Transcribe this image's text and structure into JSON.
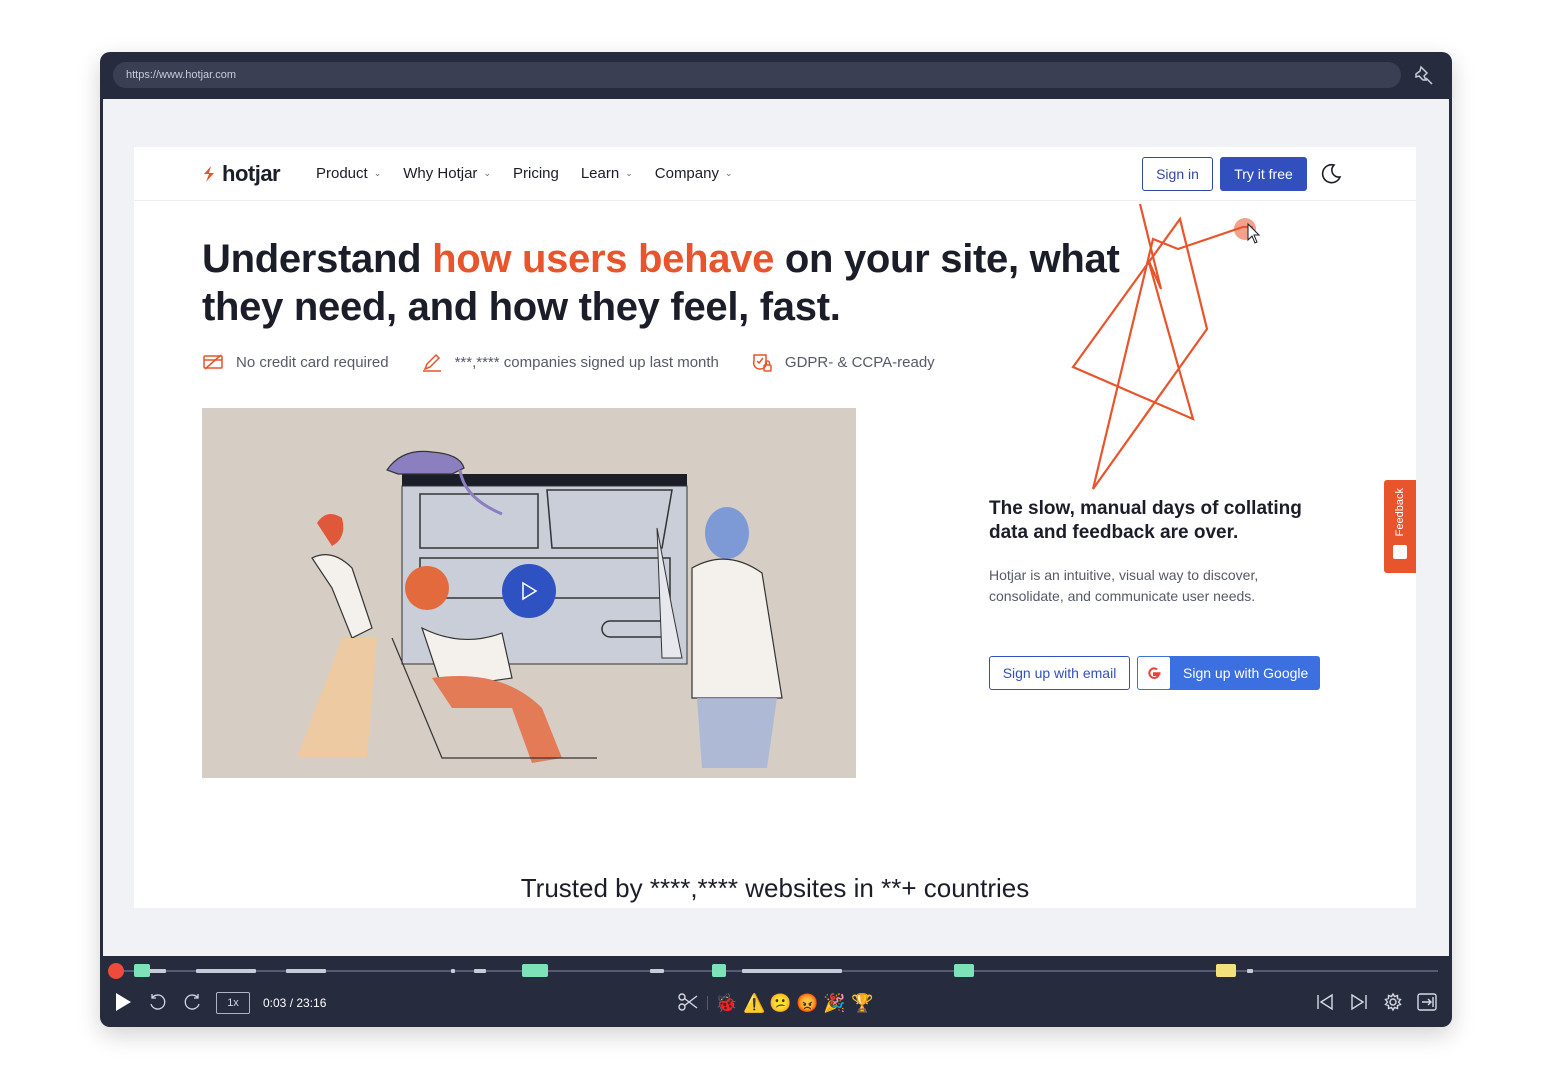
{
  "browser": {
    "url": "https://www.hotjar.com"
  },
  "site": {
    "logo": "hotjar",
    "nav": [
      "Product",
      "Why Hotjar",
      "Pricing",
      "Learn",
      "Company"
    ],
    "nav_dropdown": [
      true,
      true,
      false,
      true,
      true
    ],
    "signin": "Sign in",
    "try_free": "Try it free",
    "headline_before": "Understand ",
    "headline_accent": "how users behave",
    "headline_after": " on your site, what they need, and how they feel, fast.",
    "features": [
      {
        "icon": "no-card-icon",
        "text": "No credit card required"
      },
      {
        "icon": "pencil-icon",
        "text": "***,**** companies signed up last month"
      },
      {
        "icon": "shield-check-icon",
        "text": "GDPR- & CCPA-ready"
      }
    ],
    "side_title": "The slow, manual days of collating data and feedback are over.",
    "side_desc": "Hotjar is an intuitive, visual way to discover, consolidate, and communicate user needs.",
    "signup_email": "Sign up with email",
    "signup_google": "Sign up with Google",
    "feedback": "Feedback",
    "trusted": "Trusted by ****,**** websites in **+ countries"
  },
  "player": {
    "speed": "1x",
    "time": "0:03 / 23:16",
    "accent_color": "#ef4b3c",
    "event_icons": [
      "ladybug",
      "warning",
      "confused-face",
      "angry-face",
      "party-popper",
      "trophy"
    ]
  },
  "colors": {
    "brand": "#e8542c",
    "primary": "#324fbe",
    "player_bg": "#272b3e"
  }
}
